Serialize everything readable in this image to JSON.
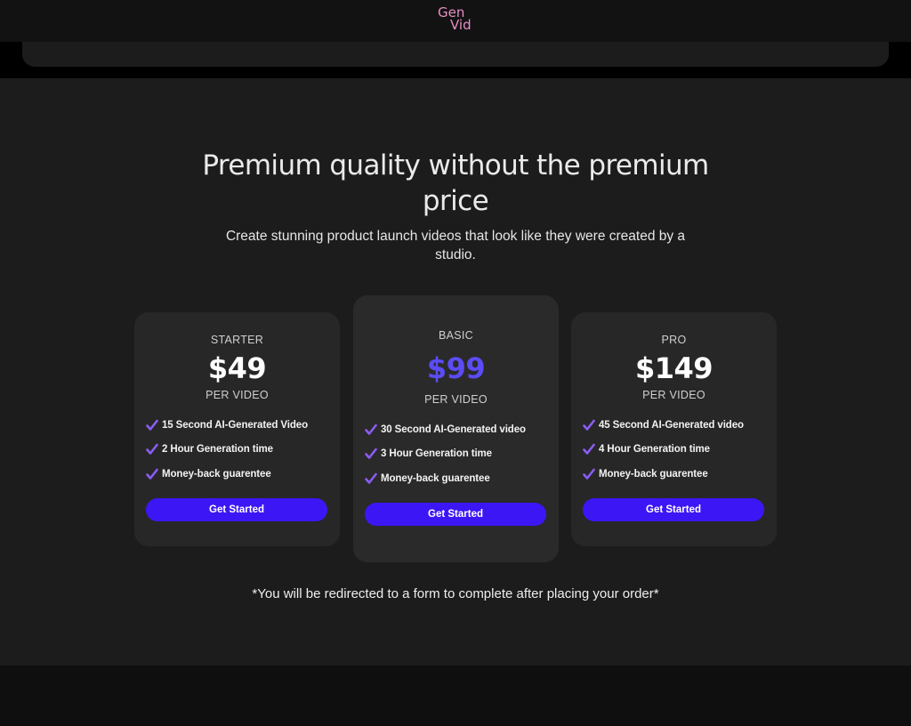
{
  "header": {
    "logo_line1": "Gen",
    "logo_line2": "Vid",
    "logo_color": "#e68fc4"
  },
  "pricing": {
    "headline": "Premium quality without the premium price",
    "subheadline": "Create stunning product launch videos that look like they were created by a studio.",
    "footnote": "*You will be redirected to a form to complete after placing your order*",
    "accent_color": "#3d16f5",
    "check_color": "#8b5cf6",
    "plans": [
      {
        "tier": "STARTER",
        "price": "$49",
        "per": "PER VIDEO",
        "features": [
          "15 Second AI-Generated Video",
          "2 Hour Generation time",
          "Money-back guarentee"
        ],
        "button": "Get Started"
      },
      {
        "tier": "BASIC",
        "price": "$99",
        "price_color": "#5b4cf5",
        "per": "PER VIDEO",
        "features": [
          "30 Second AI-Generated video",
          "3 Hour Generation time",
          "Money-back guarentee"
        ],
        "button": "Get Started"
      },
      {
        "tier": "PRO",
        "price": "$149",
        "per": "PER VIDEO",
        "features": [
          "45 Second AI-Generated video",
          "4 Hour Generation time",
          "Money-back guarentee"
        ],
        "button": "Get Started"
      }
    ]
  }
}
